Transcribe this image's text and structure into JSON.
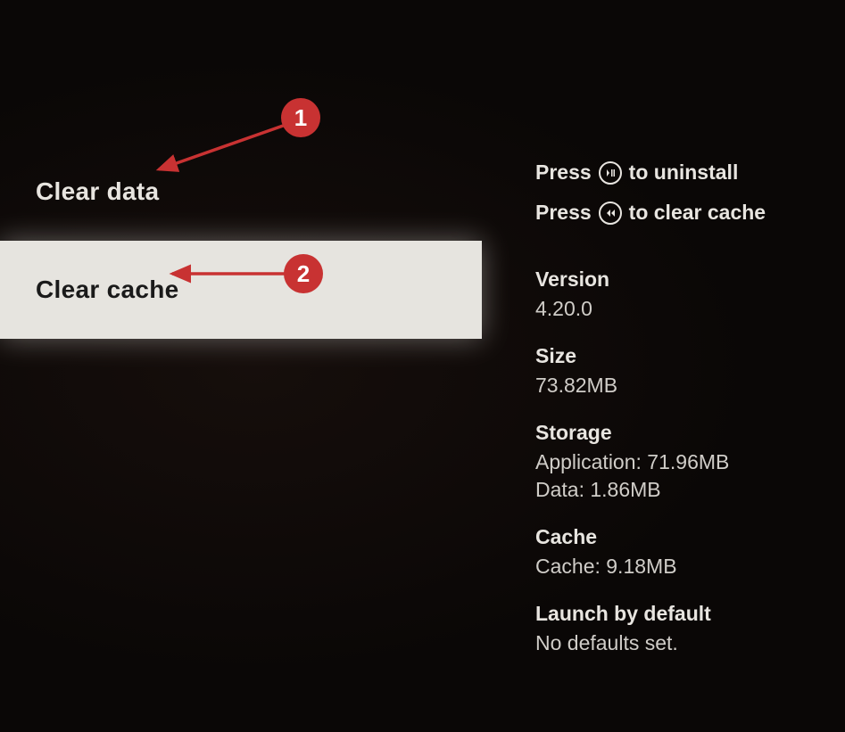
{
  "menu": {
    "clear_data": "Clear data",
    "clear_cache": "Clear cache"
  },
  "hints": {
    "uninstall_pre": "Press",
    "uninstall_post": "to uninstall",
    "clearcache_pre": "Press",
    "clearcache_post": "to clear cache"
  },
  "info": {
    "version_label": "Version",
    "version_value": "4.20.0",
    "size_label": "Size",
    "size_value": "73.82MB",
    "storage_label": "Storage",
    "storage_application": "Application: 71.96MB",
    "storage_data": "Data: 1.86MB",
    "cache_label": "Cache",
    "cache_value": "Cache: 9.18MB",
    "launch_label": "Launch by default",
    "launch_value": "No defaults set."
  },
  "callouts": {
    "one": "1",
    "two": "2"
  }
}
